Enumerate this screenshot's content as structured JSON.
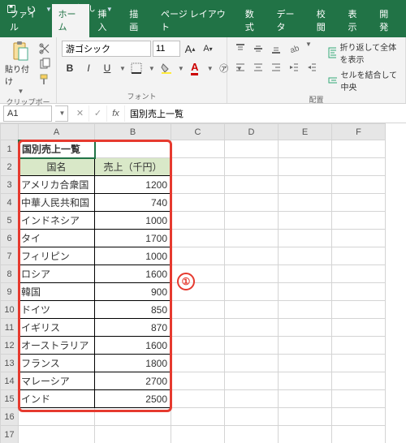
{
  "qat": {
    "save": "保存",
    "undo": "元に戻す",
    "redo": "やり直し"
  },
  "tabs": {
    "file": "ファイル",
    "home": "ホーム",
    "insert": "挿入",
    "draw": "描画",
    "pageLayout": "ページ レイアウト",
    "formulas": "数式",
    "data": "データ",
    "review": "校閲",
    "view": "表示",
    "developer": "開発"
  },
  "ribbon": {
    "clipboard": {
      "paste": "貼り付け",
      "label": "クリップボード"
    },
    "font": {
      "name": "游ゴシック",
      "size": "11",
      "bold": "B",
      "italic": "I",
      "underline": "U",
      "label": "フォント"
    },
    "align": {
      "wrap": "折り返して全体を表示",
      "merge": "セルを結合して中央",
      "label": "配置"
    }
  },
  "formulaBar": {
    "nameBox": "A1",
    "fx": "fx",
    "value": "国別売上一覧"
  },
  "columns": [
    "A",
    "B",
    "C",
    "D",
    "E",
    "F"
  ],
  "sheet": {
    "title": "国別売上一覧",
    "headers": {
      "country": "国名",
      "sales": "売上（千円）"
    },
    "rows": [
      {
        "country": "アメリカ合衆国",
        "sales": "1200"
      },
      {
        "country": "中華人民共和国",
        "sales": "740"
      },
      {
        "country": "インドネシア",
        "sales": "1000"
      },
      {
        "country": "タイ",
        "sales": "1700"
      },
      {
        "country": "フィリピン",
        "sales": "1000"
      },
      {
        "country": "ロシア",
        "sales": "1600"
      },
      {
        "country": "韓国",
        "sales": "900"
      },
      {
        "country": "ドイツ",
        "sales": "850"
      },
      {
        "country": "イギリス",
        "sales": "870"
      },
      {
        "country": "オーストラリア",
        "sales": "1600"
      },
      {
        "country": "フランス",
        "sales": "1800"
      },
      {
        "country": "マレーシア",
        "sales": "2700"
      },
      {
        "country": "インド",
        "sales": "2500"
      }
    ]
  },
  "annotation": "①"
}
